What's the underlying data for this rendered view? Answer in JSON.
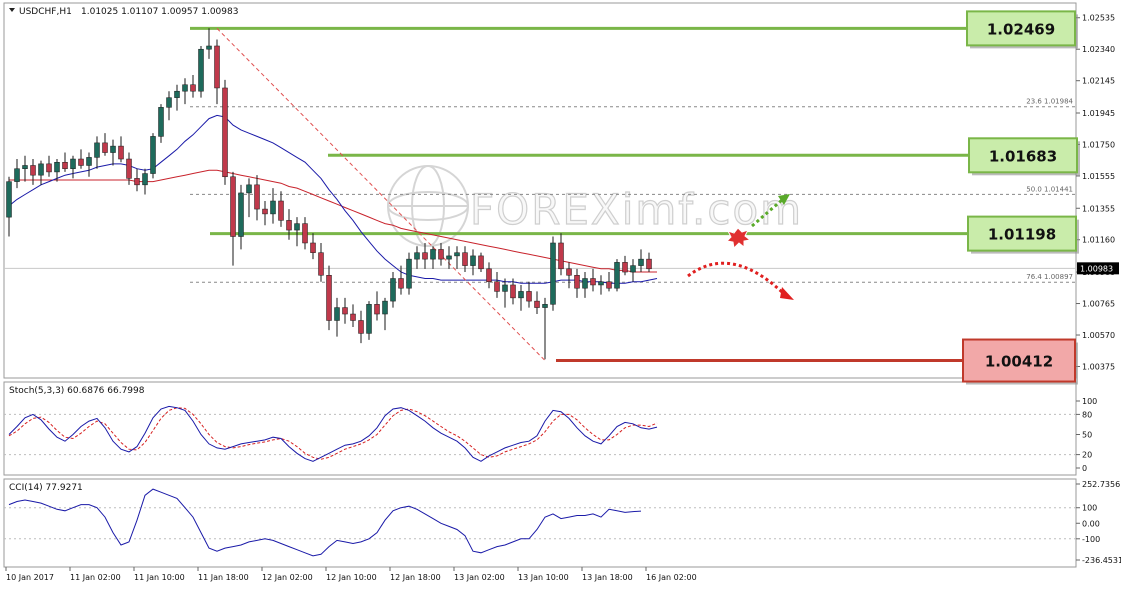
{
  "window": {
    "symbol_label": "USDCHF,H1",
    "ohlc_label": "1.01025 1.01107 1.00957 1.00983",
    "menu_icon": "triangle-down-icon"
  },
  "watermark": {
    "text": "FOREXimf.com",
    "icon": "globe-icon"
  },
  "chart_data": [
    {
      "type": "candlestick",
      "id": "price",
      "ylim": [
        1.0031,
        1.0262
      ],
      "y_ticks": [
        "1.02535",
        "1.02340",
        "1.02145",
        "1.01945",
        "1.01750",
        "1.01555",
        "1.01355",
        "1.01160",
        "1.00960",
        "1.00765",
        "1.00570",
        "1.00375"
      ],
      "current_price": "1.00983",
      "fib_levels": [
        {
          "label": "23.6  1.01984",
          "value": 1.01984
        },
        {
          "label": "50.0  1.01441",
          "value": 1.01441
        },
        {
          "label": "76.4  1.00897",
          "value": 1.00897
        }
      ],
      "key_levels": [
        {
          "label": "1.02469",
          "value": 1.02469,
          "kind": "resistance",
          "color": "#7ab648",
          "fill": "#c9ecaa"
        },
        {
          "label": "1.01683",
          "value": 1.01683,
          "kind": "resistance",
          "color": "#7ab648",
          "fill": "#c9ecaa"
        },
        {
          "label": "1.01198",
          "value": 1.01198,
          "kind": "pivot",
          "color": "#7ab648",
          "fill": "#c9ecaa"
        },
        {
          "label": "1.00412",
          "value": 1.00412,
          "kind": "support",
          "color": "#c0392b",
          "fill": "#f2a8a8"
        }
      ],
      "candles": [
        [
          1.013,
          1.0155,
          1.0118,
          1.0152
        ],
        [
          1.0152,
          1.0166,
          1.0148,
          1.016
        ],
        [
          1.016,
          1.0168,
          1.0152,
          1.0162
        ],
        [
          1.0162,
          1.0166,
          1.015,
          1.0156
        ],
        [
          1.0156,
          1.0165,
          1.015,
          1.0163
        ],
        [
          1.0163,
          1.0168,
          1.0155,
          1.0158
        ],
        [
          1.0158,
          1.0166,
          1.0152,
          1.0164
        ],
        [
          1.0164,
          1.017,
          1.0158,
          1.016
        ],
        [
          1.016,
          1.0168,
          1.0154,
          1.0166
        ],
        [
          1.0166,
          1.0172,
          1.016,
          1.0162
        ],
        [
          1.0162,
          1.017,
          1.0155,
          1.0167
        ],
        [
          1.0167,
          1.018,
          1.016,
          1.0176
        ],
        [
          1.0176,
          1.0182,
          1.0168,
          1.017
        ],
        [
          1.017,
          1.0178,
          1.0162,
          1.0174
        ],
        [
          1.0174,
          1.018,
          1.0164,
          1.0166
        ],
        [
          1.0166,
          1.017,
          1.015,
          1.0154
        ],
        [
          1.0154,
          1.016,
          1.0146,
          1.015
        ],
        [
          1.015,
          1.016,
          1.0144,
          1.0157
        ],
        [
          1.0157,
          1.0182,
          1.0154,
          1.018
        ],
        [
          1.018,
          1.02,
          1.0176,
          1.0198
        ],
        [
          1.0198,
          1.0208,
          1.019,
          1.0204
        ],
        [
          1.0204,
          1.0212,
          1.0196,
          1.0208
        ],
        [
          1.0208,
          1.0216,
          1.02,
          1.0212
        ],
        [
          1.0212,
          1.0218,
          1.0204,
          1.0208
        ],
        [
          1.0208,
          1.0236,
          1.0204,
          1.0234
        ],
        [
          1.0234,
          1.0247,
          1.0228,
          1.0236
        ],
        [
          1.0236,
          1.024,
          1.02,
          1.021
        ],
        [
          1.021,
          1.0215,
          1.015,
          1.0155
        ],
        [
          1.0155,
          1.0158,
          1.01,
          1.0118
        ],
        [
          1.0118,
          1.015,
          1.011,
          1.0145
        ],
        [
          1.0145,
          1.0154,
          1.013,
          1.015
        ],
        [
          1.015,
          1.0156,
          1.0128,
          1.0135
        ],
        [
          1.0135,
          1.014,
          1.0125,
          1.0132
        ],
        [
          1.0132,
          1.0148,
          1.0126,
          1.014
        ],
        [
          1.014,
          1.0146,
          1.0124,
          1.0128
        ],
        [
          1.0128,
          1.0135,
          1.0116,
          1.0122
        ],
        [
          1.0122,
          1.013,
          1.0112,
          1.0126
        ],
        [
          1.0126,
          1.013,
          1.011,
          1.0114
        ],
        [
          1.0114,
          1.012,
          1.0104,
          1.0108
        ],
        [
          1.0108,
          1.0114,
          1.009,
          1.0094
        ],
        [
          1.0094,
          1.01,
          1.006,
          1.0066
        ],
        [
          1.0066,
          1.008,
          1.0056,
          1.0074
        ],
        [
          1.0074,
          1.008,
          1.0064,
          1.007
        ],
        [
          1.007,
          1.0076,
          1.0062,
          1.0066
        ],
        [
          1.0066,
          1.0072,
          1.0052,
          1.0058
        ],
        [
          1.0058,
          1.0078,
          1.0054,
          1.0076
        ],
        [
          1.0076,
          1.0084,
          1.0066,
          1.007
        ],
        [
          1.007,
          1.008,
          1.006,
          1.0078
        ],
        [
          1.0078,
          1.0096,
          1.0074,
          1.0092
        ],
        [
          1.0092,
          1.01,
          1.0082,
          1.0086
        ],
        [
          1.0086,
          1.0108,
          1.0082,
          1.0104
        ],
        [
          1.0104,
          1.0112,
          1.0098,
          1.0108
        ],
        [
          1.0108,
          1.0114,
          1.0098,
          1.0104
        ],
        [
          1.0104,
          1.0112,
          1.0098,
          1.011
        ],
        [
          1.011,
          1.0114,
          1.01,
          1.0104
        ],
        [
          1.0104,
          1.0112,
          1.0098,
          1.0106
        ],
        [
          1.0106,
          1.0112,
          1.0098,
          1.0108
        ],
        [
          1.0108,
          1.0112,
          1.0096,
          1.01
        ],
        [
          1.01,
          1.011,
          1.0094,
          1.0106
        ],
        [
          1.0106,
          1.0108,
          1.0096,
          1.0098
        ],
        [
          1.0098,
          1.0102,
          1.0086,
          1.009
        ],
        [
          1.009,
          1.0096,
          1.008,
          1.0084
        ],
        [
          1.0084,
          1.0092,
          1.0074,
          1.0088
        ],
        [
          1.0088,
          1.0092,
          1.0076,
          1.008
        ],
        [
          1.008,
          1.0088,
          1.0072,
          1.0084
        ],
        [
          1.0084,
          1.009,
          1.0074,
          1.0078
        ],
        [
          1.0078,
          1.0084,
          1.007,
          1.0074
        ],
        [
          1.0074,
          1.008,
          1.0042,
          1.0076
        ],
        [
          1.0076,
          1.0118,
          1.0072,
          1.0114
        ],
        [
          1.0114,
          1.012,
          1.0094,
          1.0098
        ],
        [
          1.0098,
          1.0102,
          1.0086,
          1.0094
        ],
        [
          1.0094,
          1.0098,
          1.008,
          1.0086
        ],
        [
          1.0086,
          1.0096,
          1.008,
          1.0092
        ],
        [
          1.0092,
          1.0098,
          1.0084,
          1.0088
        ],
        [
          1.0088,
          1.0094,
          1.0082,
          1.009
        ],
        [
          1.009,
          1.0096,
          1.0084,
          1.0086
        ],
        [
          1.0086,
          1.0104,
          1.0084,
          1.0102
        ],
        [
          1.0102,
          1.0106,
          1.0094,
          1.0096
        ],
        [
          1.0096,
          1.0104,
          1.009,
          1.01
        ],
        [
          1.01,
          1.011,
          1.0096,
          1.0104
        ],
        [
          1.0104,
          1.0108,
          1.0096,
          1.0098
        ]
      ],
      "ma_fast": [
        1.0137,
        1.0141,
        1.0144,
        1.0147,
        1.015,
        1.0152,
        1.0154,
        1.0156,
        1.0157,
        1.0158,
        1.0159,
        1.0161,
        1.0162,
        1.0163,
        1.0163,
        1.0162,
        1.016,
        1.0159,
        1.016,
        1.0164,
        1.0168,
        1.0172,
        1.0177,
        1.0181,
        1.0186,
        1.0191,
        1.0193,
        1.0192,
        1.0187,
        1.0184,
        1.0182,
        1.018,
        1.0178,
        1.0176,
        1.0173,
        1.017,
        1.0167,
        1.0164,
        1.0159,
        1.0154,
        1.0147,
        1.0141,
        1.0134,
        1.0128,
        1.0121,
        1.0115,
        1.0109,
        1.0104,
        1.01,
        1.0096,
        1.0094,
        1.0093,
        1.0092,
        1.0092,
        1.0091,
        1.0091,
        1.0091,
        1.0091,
        1.0091,
        1.0091,
        1.0091,
        1.0091,
        1.009,
        1.009,
        1.0089,
        1.0089,
        1.0089,
        1.0089,
        1.009,
        1.0091,
        1.0091,
        1.0091,
        1.009,
        1.009,
        1.009,
        1.0089,
        1.0089,
        1.0089,
        1.009,
        1.009,
        1.0091,
        1.0092
      ],
      "ma_slow": [
        1.0153,
        1.0153,
        1.0153,
        1.0153,
        1.0153,
        1.0153,
        1.0153,
        1.0153,
        1.0153,
        1.0153,
        1.0153,
        1.0153,
        1.0153,
        1.0153,
        1.0153,
        1.0153,
        1.0152,
        1.0152,
        1.0152,
        1.0153,
        1.0154,
        1.0155,
        1.0156,
        1.0157,
        1.0158,
        1.0159,
        1.0159,
        1.0158,
        1.0157,
        1.0156,
        1.0155,
        1.0154,
        1.0153,
        1.0152,
        1.0151,
        1.0149,
        1.0148,
        1.0146,
        1.0144,
        1.0142,
        1.014,
        1.0138,
        1.0136,
        1.0134,
        1.0132,
        1.013,
        1.0128,
        1.0126,
        1.0125,
        1.0123,
        1.0122,
        1.0121,
        1.012,
        1.0119,
        1.0118,
        1.0117,
        1.0116,
        1.0115,
        1.0114,
        1.0113,
        1.0112,
        1.0111,
        1.011,
        1.0109,
        1.0108,
        1.0107,
        1.0106,
        1.0105,
        1.0104,
        1.0103,
        1.0102,
        1.0101,
        1.01,
        1.0099,
        1.0098,
        1.0098,
        1.0097,
        1.0097,
        1.0096,
        1.0096,
        1.0096,
        1.0096
      ],
      "trendline": {
        "from": [
          26,
          1.02469
        ],
        "to": [
          67,
          1.00412
        ]
      }
    },
    {
      "type": "line",
      "id": "stochastic",
      "title": "Stoch(5,3,3) 60.6876 66.7998",
      "ylim": [
        0,
        100
      ],
      "y_ticks": [
        "100",
        "80",
        "50",
        "20",
        "0"
      ],
      "series": [
        {
          "values": [
            50,
            62,
            75,
            80,
            72,
            58,
            46,
            40,
            50,
            62,
            70,
            74,
            60,
            40,
            28,
            24,
            32,
            52,
            75,
            88,
            92,
            90,
            86,
            70,
            50,
            36,
            30,
            28,
            32,
            36,
            38,
            40,
            42,
            46,
            44,
            32,
            22,
            14,
            10,
            16,
            22,
            28,
            34,
            36,
            40,
            48,
            60,
            78,
            88,
            90,
            86,
            78,
            70,
            60,
            52,
            46,
            40,
            30,
            16,
            10,
            18,
            24,
            30,
            34,
            38,
            40,
            48,
            70,
            86,
            84,
            74,
            60,
            48,
            40,
            36,
            48,
            62,
            68,
            66,
            60,
            58,
            61
          ]
        },
        {
          "values": [
            48,
            55,
            66,
            74,
            76,
            68,
            56,
            46,
            44,
            52,
            62,
            70,
            66,
            52,
            38,
            28,
            27,
            38,
            56,
            74,
            86,
            90,
            89,
            80,
            66,
            50,
            38,
            32,
            30,
            32,
            35,
            37,
            39,
            42,
            44,
            40,
            32,
            22,
            16,
            13,
            16,
            22,
            28,
            32,
            36,
            42,
            50,
            64,
            78,
            86,
            88,
            84,
            78,
            70,
            62,
            54,
            48,
            40,
            30,
            20,
            16,
            18,
            24,
            28,
            32,
            36,
            42,
            54,
            70,
            80,
            80,
            72,
            60,
            50,
            42,
            42,
            50,
            60,
            64,
            64,
            62,
            67
          ]
        }
      ]
    },
    {
      "type": "line",
      "id": "cci",
      "title": "CCI(14) 77.9271",
      "ylim": [
        -236.4531,
        252.7356
      ],
      "y_ticks": [
        "252.7356",
        "100",
        "0.00",
        "-100",
        "-236.4531"
      ],
      "series": [
        {
          "values": [
            120,
            140,
            150,
            140,
            130,
            110,
            90,
            80,
            100,
            120,
            120,
            100,
            40,
            -60,
            -140,
            -120,
            20,
            180,
            220,
            200,
            180,
            160,
            100,
            40,
            -60,
            -160,
            -180,
            -160,
            -150,
            -140,
            -120,
            -110,
            -100,
            -110,
            -130,
            -150,
            -170,
            -190,
            -210,
            -200,
            -150,
            -110,
            -120,
            -130,
            -120,
            -100,
            -60,
            20,
            80,
            100,
            110,
            90,
            60,
            30,
            0,
            -20,
            -40,
            -80,
            -180,
            -190,
            -170,
            -150,
            -140,
            -120,
            -100,
            -100,
            -40,
            40,
            60,
            30,
            40,
            50,
            50,
            60,
            40,
            90,
            80,
            70,
            75,
            78
          ]
        }
      ]
    }
  ],
  "x_axis_labels": [
    "10 Jan 2017",
    "11 Jan 02:00",
    "11 Jan 10:00",
    "11 Jan 18:00",
    "12 Jan 02:00",
    "12 Jan 10:00",
    "12 Jan 18:00",
    "13 Jan 02:00",
    "13 Jan 10:00",
    "13 Jan 18:00",
    "16 Jan 02:00"
  ],
  "colors": {
    "bull": "#1e6b5c",
    "bear": "#c0394b",
    "ma_fast": "#1a1aa8",
    "ma_slow": "#c8232c",
    "trendline": "#e05050",
    "fib": "#888888",
    "arrow_up": "#5aaa2a",
    "arrow_down": "#e02020",
    "osc_main": "#1a1aa8",
    "osc_signal": "#d62020"
  },
  "annotations": [
    {
      "kind": "arrow",
      "direction": "up",
      "style": "dotted-green",
      "icon": "arrow-up-right-icon"
    },
    {
      "kind": "arrow",
      "direction": "down",
      "style": "dotted-red",
      "icon": "arrow-curve-down-icon"
    },
    {
      "kind": "burst",
      "icon": "breakout-burst-icon"
    }
  ]
}
